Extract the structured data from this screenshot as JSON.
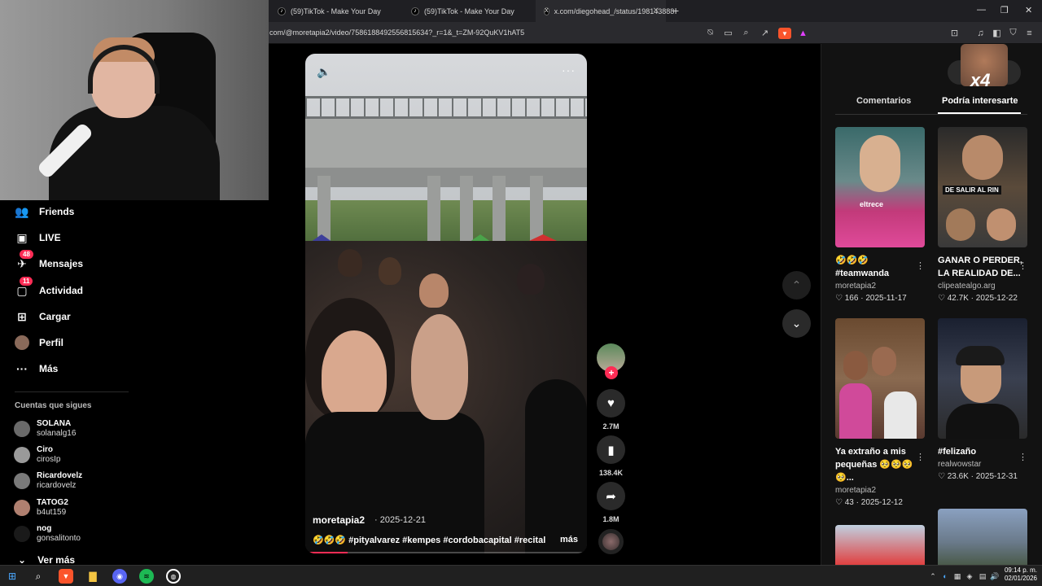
{
  "browser": {
    "tabs": [
      {
        "label": "(59)TikTok - Make Your Day",
        "icon": "tiktok-icon"
      },
      {
        "label": "(59)TikTok - Make Your Day",
        "icon": "tiktok-icon"
      },
      {
        "label": "x.com/diegohead_/status/198143888",
        "icon": "x-icon"
      }
    ],
    "url": "com/@moretapia2/video/7586188492556815634?_r=1&_t=ZM-92QuKV1hAT5"
  },
  "sidebar": {
    "items": [
      {
        "label": "Friends",
        "icon": "friends-icon"
      },
      {
        "label": "LIVE",
        "icon": "live-icon"
      },
      {
        "label": "Mensajes",
        "icon": "messages-icon",
        "badge": "48"
      },
      {
        "label": "Actividad",
        "icon": "activity-icon",
        "badge": "11"
      },
      {
        "label": "Cargar",
        "icon": "upload-icon"
      },
      {
        "label": "Perfil",
        "icon": "profile-avatar"
      },
      {
        "label": "Más",
        "icon": "more-icon"
      }
    ],
    "following_title": "Cuentas que sigues",
    "accounts": [
      {
        "name": "SOLANA",
        "handle": "solanalg16"
      },
      {
        "name": "Ciro",
        "handle": "cirosIp"
      },
      {
        "name": "Ricardovelz",
        "handle": "ricardovelz"
      },
      {
        "name": "TATOG2",
        "handle": "b4ut159"
      },
      {
        "name": "nog",
        "handle": "gonsalitonto"
      }
    ],
    "see_more": "Ver más"
  },
  "video": {
    "author": "moretapia2",
    "date": "· 2025-12-21",
    "caption": "🤣🤣🤣 #pityalvarez #kempes #cordobacapital #recital ...",
    "more_label": "más",
    "progress": 0.15
  },
  "actions": {
    "likes": "2.7M",
    "saves": "138.4K",
    "shares": "1.8M"
  },
  "right_panel": {
    "tabs": [
      "Comentarios",
      "Podría interesarte"
    ],
    "overlay_text": "x4",
    "cards": [
      {
        "title": "🤣🤣🤣 #teamwanda",
        "user": "moretapia2",
        "likes": "166",
        "date": "2025-11-17",
        "thumb_text": "eltrece"
      },
      {
        "title": "GANAR O PERDER, LA REALIDAD DE...",
        "user": "clipeatealgo.arg",
        "likes": "42.7K",
        "date": "2025-12-22",
        "thumb_text": "DE SALIR AL RIN"
      },
      {
        "title": "Ya extraño a mis pequeñas 🥺🥺🥺🥺...",
        "user": "moretapia2",
        "likes": "43",
        "date": "2025-12-12",
        "thumb_text": ""
      },
      {
        "title": "#felizaño",
        "user": "realwowstar",
        "likes": "23.6K",
        "date": "2025-12-31",
        "thumb_text": ""
      }
    ]
  },
  "taskbar": {
    "time": "09:14 p. m.",
    "date": "02/01/2026"
  }
}
